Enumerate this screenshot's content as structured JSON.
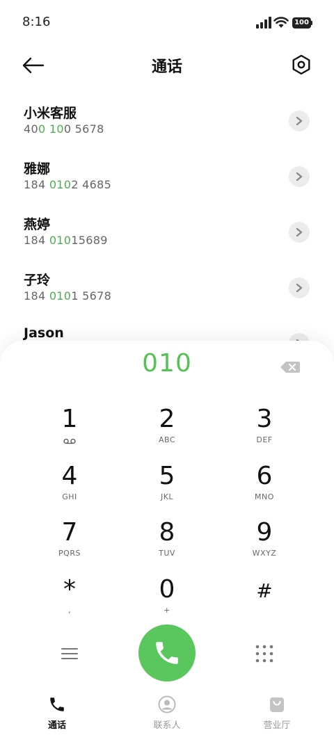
{
  "status_bar": {
    "time": "8:16",
    "battery": "100"
  },
  "header": {
    "title": "通话"
  },
  "contacts": [
    {
      "name": "小米客服",
      "number_parts": [
        {
          "t": "40",
          "hl": false
        },
        {
          "t": "0",
          "hl": true
        },
        {
          "t": " ",
          "hl": false
        },
        {
          "t": "10",
          "hl": true
        },
        {
          "t": "0 5678",
          "hl": false
        }
      ]
    },
    {
      "name": "雅娜",
      "number_parts": [
        {
          "t": "184 ",
          "hl": false
        },
        {
          "t": "010",
          "hl": true
        },
        {
          "t": "2 4685",
          "hl": false
        }
      ]
    },
    {
      "name": "燕婷",
      "number_parts": [
        {
          "t": "184 ",
          "hl": false
        },
        {
          "t": "010",
          "hl": true
        },
        {
          "t": "15689",
          "hl": false
        }
      ]
    },
    {
      "name": "子玲",
      "number_parts": [
        {
          "t": "184 ",
          "hl": false
        },
        {
          "t": "010",
          "hl": true
        },
        {
          "t": "1 5678",
          "hl": false
        }
      ]
    },
    {
      "name": "Jason",
      "number_parts": []
    }
  ],
  "dialer": {
    "entered": "010",
    "keys": [
      {
        "digit": "1",
        "letters": "voicemail-icon"
      },
      {
        "digit": "2",
        "letters": "ABC"
      },
      {
        "digit": "3",
        "letters": "DEF"
      },
      {
        "digit": "4",
        "letters": "GHI"
      },
      {
        "digit": "5",
        "letters": "JKL"
      },
      {
        "digit": "6",
        "letters": "MNO"
      },
      {
        "digit": "7",
        "letters": "PQRS"
      },
      {
        "digit": "8",
        "letters": "TUV"
      },
      {
        "digit": "9",
        "letters": "WXYZ"
      },
      {
        "digit": "*",
        "letters": ","
      },
      {
        "digit": "0",
        "letters": "+"
      },
      {
        "digit": "#",
        "letters": ""
      }
    ]
  },
  "nav": {
    "calls": "通话",
    "contacts": "联系人",
    "store": "营业厅"
  },
  "colors": {
    "accent": "#56c157",
    "call_button": "#59c75d",
    "muted": "#999999"
  }
}
